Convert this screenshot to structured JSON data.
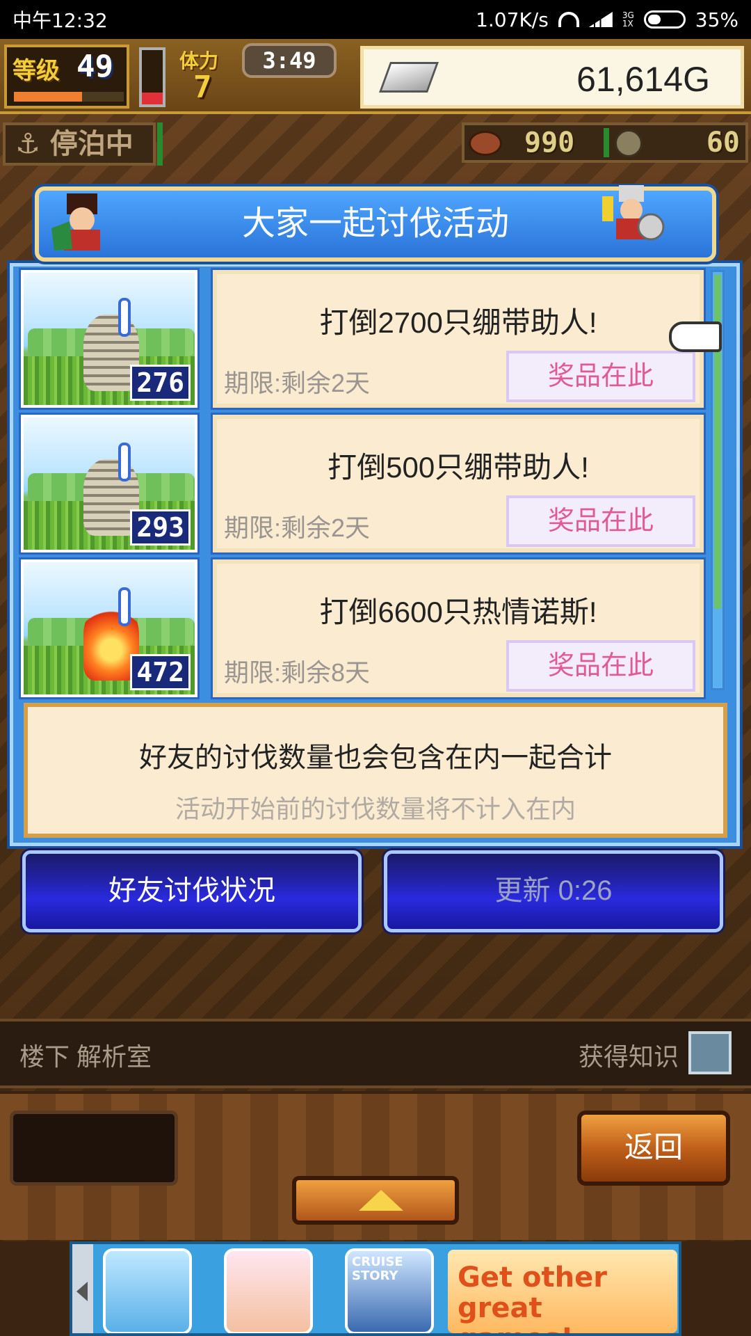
{
  "status_bar": {
    "time": "中午12:32",
    "net_speed": "1.07K/s",
    "network_type": "3G\n1X",
    "battery": "35%"
  },
  "hud": {
    "level_label": "等级",
    "level_value": "49",
    "xp_fraction": 0.62,
    "stamina_fraction": 0.22,
    "stamina_label": "体力",
    "stamina_value": "7",
    "timer": "3:49",
    "gold": "61,614G",
    "dock_status": "停泊中",
    "food": "990",
    "coins": "60"
  },
  "dialog": {
    "title": "大家一起讨伐活动",
    "missions": [
      {
        "count": "276",
        "monster": "mummy",
        "title": "打倒2700只绷带助人!",
        "deadline": "期限:剩余2天",
        "reward_label": "奖品在此"
      },
      {
        "count": "293",
        "monster": "mummy",
        "title": "打倒500只绷带助人!",
        "deadline": "期限:剩余2天",
        "reward_label": "奖品在此"
      },
      {
        "count": "472",
        "monster": "flame",
        "title": "打倒6600只热情诺斯!",
        "deadline": "期限:剩余8天",
        "reward_label": "奖品在此"
      }
    ],
    "note_main": "好友的讨伐数量也会包含在内一起合计",
    "note_sub": "活动开始前的讨伐数量将不计入在内",
    "friends_button": "好友讨伐状况",
    "refresh_button": "更新 0:26"
  },
  "info_bar": {
    "location": "楼下 解析室",
    "action": "获得知识"
  },
  "bottom": {
    "back_button": "返回"
  },
  "ad": {
    "icon3_text": "CRUISE\nSTORY",
    "cta": "Get other great games!"
  },
  "colors": {
    "dialog_blue": "#3b8ee0",
    "card_cream": "#fbecd1",
    "reward_pink": "#e05a9a",
    "gold_text": "#f2cf3a"
  }
}
